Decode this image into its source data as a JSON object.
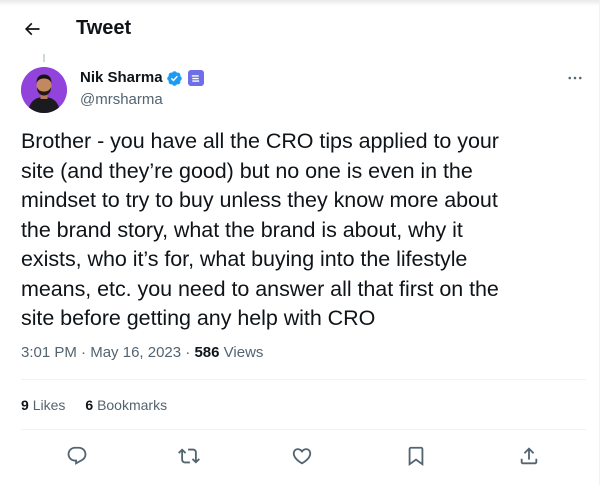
{
  "header": {
    "title": "Tweet",
    "back_icon": "arrow-left-icon"
  },
  "author": {
    "name": "Nik Sharma",
    "handle": "@mrsharma",
    "verified_badge": "verified-checkmark-icon",
    "affiliate_badge": "affiliate-badge-icon",
    "avatar_bg": "#8a3bd7"
  },
  "tweet": {
    "text": "Brother - you have all the CRO tips applied to your\nsite (and they’re good) but no one is even in the\nmindset to try to buy unless they know more about\nthe brand story, what the brand is about, why it\nexists, who it’s for, what buying into the lifestyle\nmeans, etc. you need to answer all that first on the\nsite before getting any help with CRO",
    "time": "3:01 PM",
    "separator": "·",
    "date": "May 16, 2023",
    "views_count": "586",
    "views_label": "Views"
  },
  "stats": {
    "likes_count": "9",
    "likes_label": "Likes",
    "bookmarks_count": "6",
    "bookmarks_label": "Bookmarks"
  },
  "actions": [
    "reply-icon",
    "retweet-icon",
    "like-icon",
    "bookmark-icon",
    "share-icon"
  ],
  "colors": {
    "text_primary": "#0f1419",
    "text_secondary": "#536471",
    "verified_blue": "#1d9bf0",
    "divider": "#eff3f4",
    "affiliate_purple": "#6e6ee8"
  }
}
